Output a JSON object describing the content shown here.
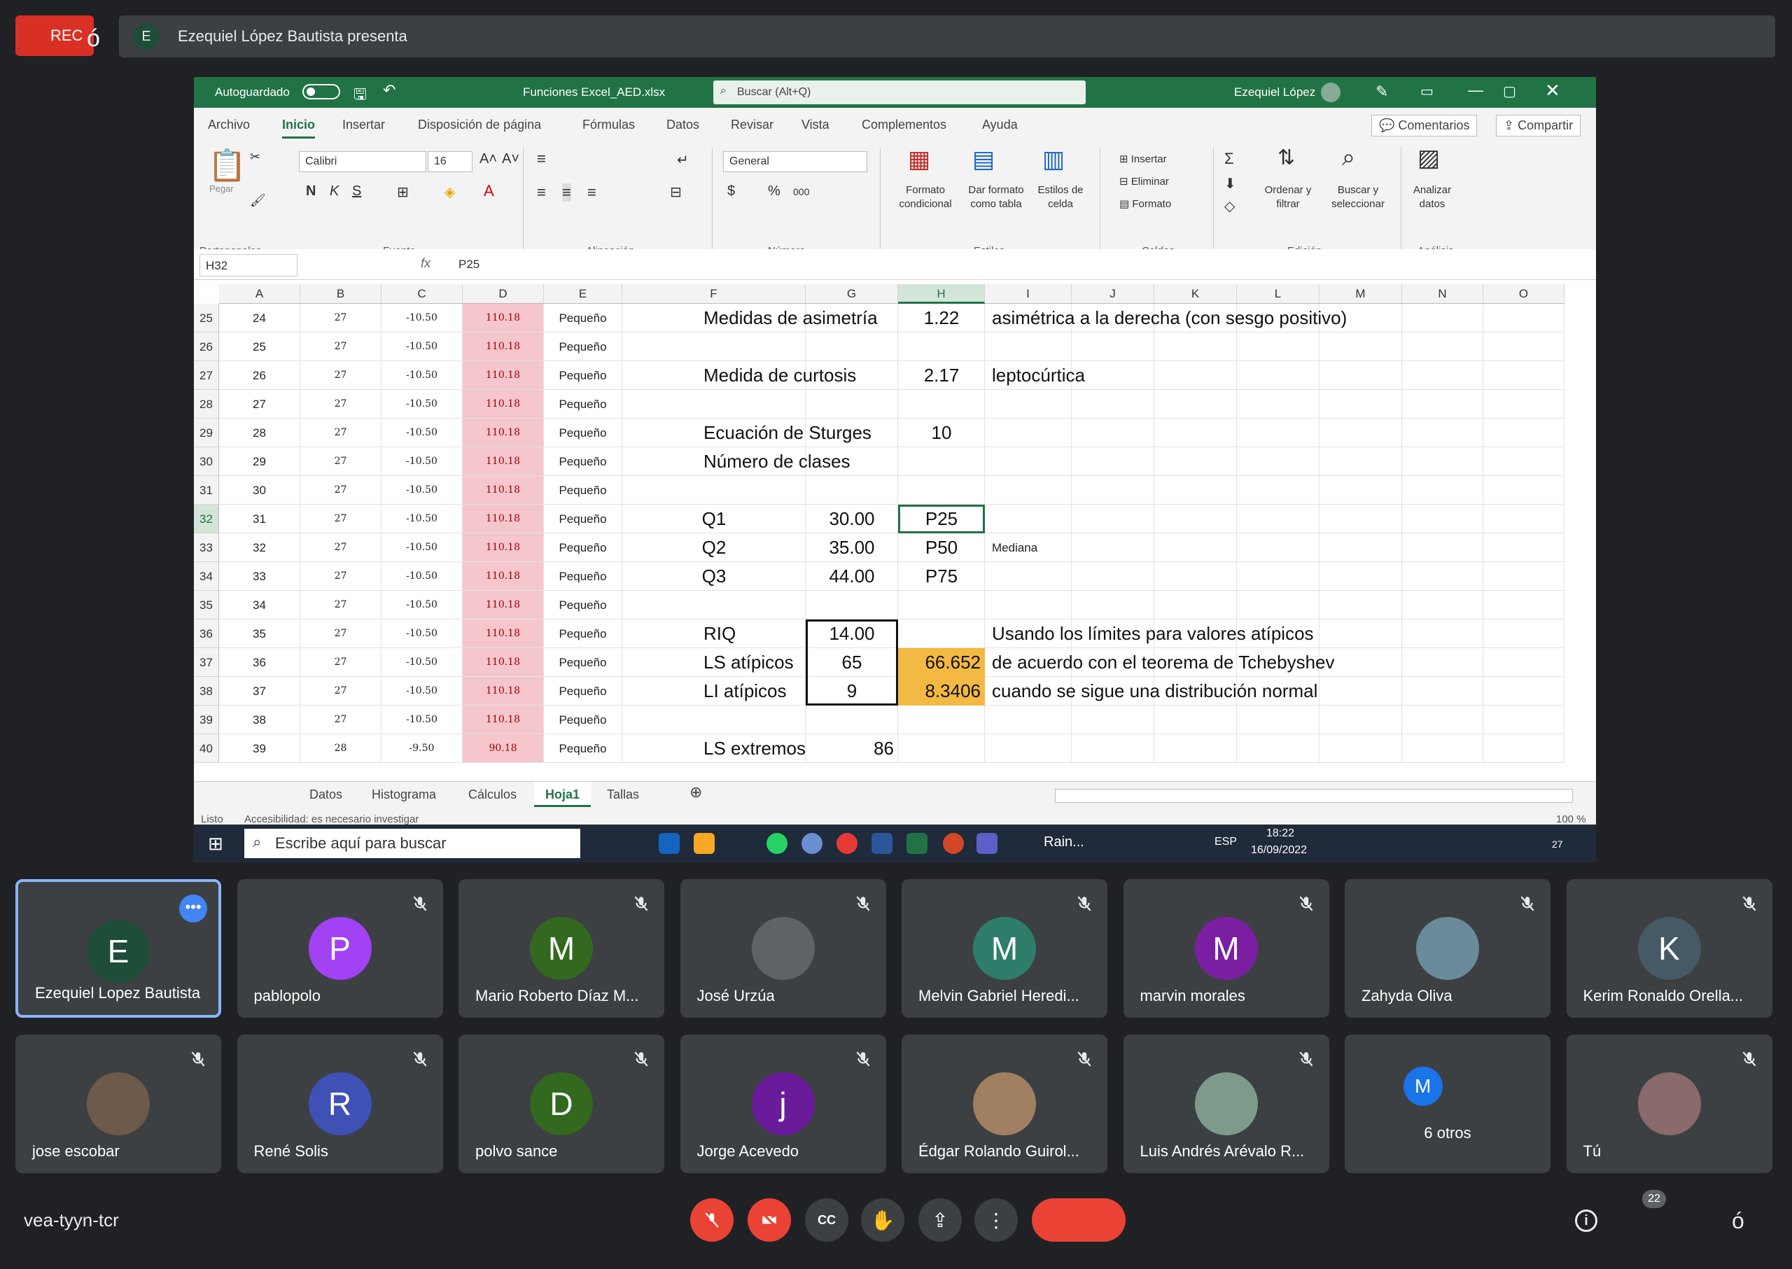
{
  "meet": {
    "rec_label": "REC",
    "rec_suffix": "ó",
    "presenter_initial": "E",
    "presenter_text": "Ezequiel López Bautista presenta",
    "meeting_code": "vea-tyyn-tcr",
    "participant_count": "22",
    "corner_glyph": "ó",
    "more_glyph": "⋮",
    "more_dots": "•••"
  },
  "excel": {
    "autosave_label": "Autoguardado",
    "filename": "Funciones Excel_AED.xlsx",
    "search_placeholder": "Buscar (Alt+Q)",
    "user": "Ezequiel López",
    "menu": [
      "Archivo",
      "Inicio",
      "Insertar",
      "Disposición de página",
      "Fórmulas",
      "Datos",
      "Revisar",
      "Vista",
      "Complementos",
      "Ayuda"
    ],
    "comments": "Comentarios",
    "share": "Compartir",
    "ribbon": {
      "paste": "Pegar",
      "font_name": "Calibri",
      "font_size": "16",
      "format_general": "General",
      "group_labels": [
        "Portapapeles",
        "Fuente",
        "Alineación",
        "Número",
        "Estilos",
        "Celdas",
        "Edición",
        "Análisis"
      ],
      "estilos_items": [
        "Formato condicional",
        "Dar formato como tabla",
        "Estilos de celda"
      ],
      "celdas_items": [
        "Insertar",
        "Eliminar",
        "Formato"
      ],
      "edicion_items": [
        "Ordenar y filtrar",
        "Buscar y seleccionar"
      ],
      "analisis_item": "Analizar datos"
    },
    "name_box": "H32",
    "formula": "P25",
    "columns": [
      "A",
      "B",
      "C",
      "D",
      "E",
      "F",
      "G",
      "H",
      "I",
      "J",
      "K",
      "L",
      "M",
      "N",
      "O"
    ],
    "rows": [
      {
        "n": "25",
        "a": "24",
        "b": "27",
        "c": "-10.50",
        "d": "110.18",
        "e": "Pequeño"
      },
      {
        "n": "26",
        "a": "25",
        "b": "27",
        "c": "-10.50",
        "d": "110.18",
        "e": "Pequeño"
      },
      {
        "n": "27",
        "a": "26",
        "b": "27",
        "c": "-10.50",
        "d": "110.18",
        "e": "Pequeño"
      },
      {
        "n": "28",
        "a": "27",
        "b": "27",
        "c": "-10.50",
        "d": "110.18",
        "e": "Pequeño"
      },
      {
        "n": "29",
        "a": "28",
        "b": "27",
        "c": "-10.50",
        "d": "110.18",
        "e": "Pequeño"
      },
      {
        "n": "30",
        "a": "29",
        "b": "27",
        "c": "-10.50",
        "d": "110.18",
        "e": "Pequeño"
      },
      {
        "n": "31",
        "a": "30",
        "b": "27",
        "c": "-10.50",
        "d": "110.18",
        "e": "Pequeño"
      },
      {
        "n": "32",
        "a": "31",
        "b": "27",
        "c": "-10.50",
        "d": "110.18",
        "e": "Pequeño"
      },
      {
        "n": "33",
        "a": "32",
        "b": "27",
        "c": "-10.50",
        "d": "110.18",
        "e": "Pequeño"
      },
      {
        "n": "34",
        "a": "33",
        "b": "27",
        "c": "-10.50",
        "d": "110.18",
        "e": "Pequeño"
      },
      {
        "n": "35",
        "a": "34",
        "b": "27",
        "c": "-10.50",
        "d": "110.18",
        "e": "Pequeño"
      },
      {
        "n": "36",
        "a": "35",
        "b": "27",
        "c": "-10.50",
        "d": "110.18",
        "e": "Pequeño"
      },
      {
        "n": "37",
        "a": "36",
        "b": "27",
        "c": "-10.50",
        "d": "110.18",
        "e": "Pequeño"
      },
      {
        "n": "38",
        "a": "37",
        "b": "27",
        "c": "-10.50",
        "d": "110.18",
        "e": "Pequeño"
      },
      {
        "n": "39",
        "a": "38",
        "b": "27",
        "c": "-10.50",
        "d": "110.18",
        "e": "Pequeño"
      },
      {
        "n": "40",
        "a": "39",
        "b": "28",
        "c": "-9.50",
        "d": "90.18",
        "e": "Pequeño"
      }
    ],
    "stats": {
      "asimetria_label": "Medidas de asimetría",
      "asimetria_val": "1.22",
      "asimetria_note": "asimétrica a la derecha (con sesgo positivo)",
      "curtosis_label": "Medida de curtosis",
      "curtosis_val": "2.17",
      "curtosis_note": "leptocúrtica",
      "sturges_label": "Ecuación de Sturges",
      "sturges_val": "10",
      "clases_label": "Número de clases",
      "q1": "Q1",
      "q1_val": "30.00",
      "q1_p": "P25",
      "q2": "Q2",
      "q2_val": "35.00",
      "q2_p": "P50",
      "mediana": "Mediana",
      "q3": "Q3",
      "q3_val": "44.00",
      "q3_p": "P75",
      "riq_label": "RIQ",
      "riq_val": "14.00",
      "ls_label": "LS atípicos",
      "ls_val": "65",
      "ls_h": "66.652",
      "li_label": "LI atípicos",
      "li_val": "9",
      "li_h": "8.3406",
      "note1": "Usando los límites para valores atípicos",
      "note2": "de acuerdo con el teorema de Tchebyshev",
      "note3": "cuando se sigue una distribución normal",
      "lse_label": "LS extremos",
      "lse_val": "86"
    },
    "sheets": [
      "Datos",
      "Histograma",
      "Cálculos",
      "Hoja1",
      "Tallas"
    ],
    "active_sheet": "Hoja1",
    "status_ready": "Listo",
    "status_access": "Accesibilidad: es necesario investigar",
    "zoom": "100 %"
  },
  "taskbar": {
    "search": "Escribe aquí para buscar",
    "weather": "Rain...",
    "lang": "ESP",
    "time": "18:22",
    "date": "16/09/2022",
    "notif": "27"
  },
  "participants": [
    {
      "name": "Ezequiel Lopez Bautista",
      "initial": "E",
      "color": "#1e4d3a"
    },
    {
      "name": "pablopolo",
      "initial": "P",
      "color": "#a142f4"
    },
    {
      "name": "Mario Roberto Díaz M...",
      "initial": "M",
      "color": "#33691e"
    },
    {
      "name": "José Urzúa",
      "initial": "",
      "color": "#5f6368"
    },
    {
      "name": "Melvin Gabriel Heredi...",
      "initial": "M",
      "color": "#2e7d6b"
    },
    {
      "name": "marvin morales",
      "initial": "M",
      "color": "#7b1fa2"
    },
    {
      "name": "Zahyda Oliva",
      "initial": "",
      "color": "#6b8a9a"
    },
    {
      "name": "Kerim Ronaldo Orella...",
      "initial": "K",
      "color": "#455a64"
    },
    {
      "name": "jose escobar",
      "initial": "",
      "color": "#6d5a4a"
    },
    {
      "name": "René Solis",
      "initial": "R",
      "color": "#3f51b5"
    },
    {
      "name": "polvo sance",
      "initial": "D",
      "color": "#33691e"
    },
    {
      "name": "Jorge Acevedo",
      "initial": "j",
      "color": "#6a1b9a"
    },
    {
      "name": "Édgar Rolando Guirol...",
      "initial": "",
      "color": "#a08060"
    },
    {
      "name": "Luis Andrés Arévalo R...",
      "initial": "",
      "color": "#7d9a8a"
    },
    {
      "name": "6 otros",
      "initial": "M",
      "color": "#1a73e8"
    },
    {
      "name": "Tú",
      "initial": "",
      "color": "#8a6a6a"
    }
  ]
}
